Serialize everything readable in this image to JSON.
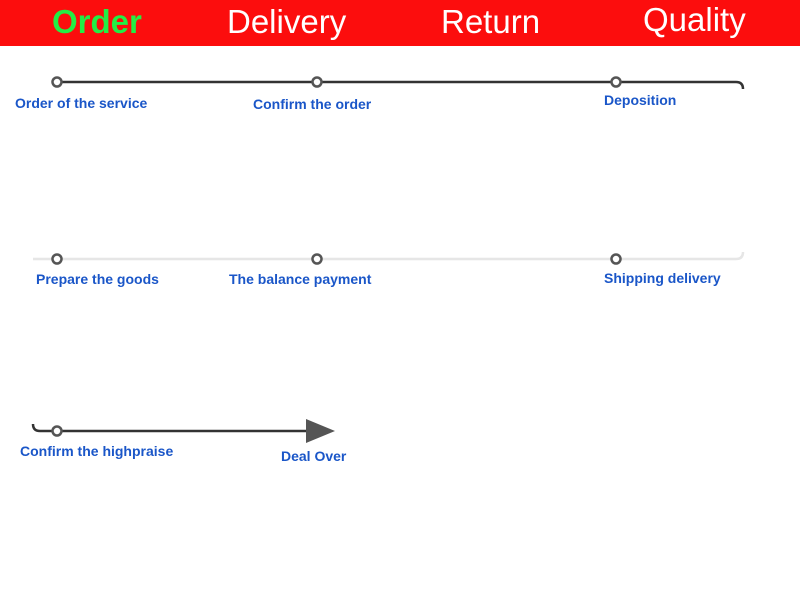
{
  "nav": {
    "tabs": [
      {
        "label": "Order",
        "active": true
      },
      {
        "label": "Delivery",
        "active": false
      },
      {
        "label": "Return",
        "active": false
      },
      {
        "label": "Quality",
        "active": false
      }
    ]
  },
  "colors": {
    "header_bg": "#fc0d0d",
    "active_tab": "#22ee44",
    "label": "#1a56c8",
    "line_dark": "#333333",
    "line_light": "#e6e6e6"
  },
  "steps": [
    "Order of the service",
    "Confirm the order",
    "Deposition",
    "Shipping delivery",
    "The balance payment",
    "Prepare the goods",
    "Confirm the highpraise",
    "Deal Over"
  ]
}
